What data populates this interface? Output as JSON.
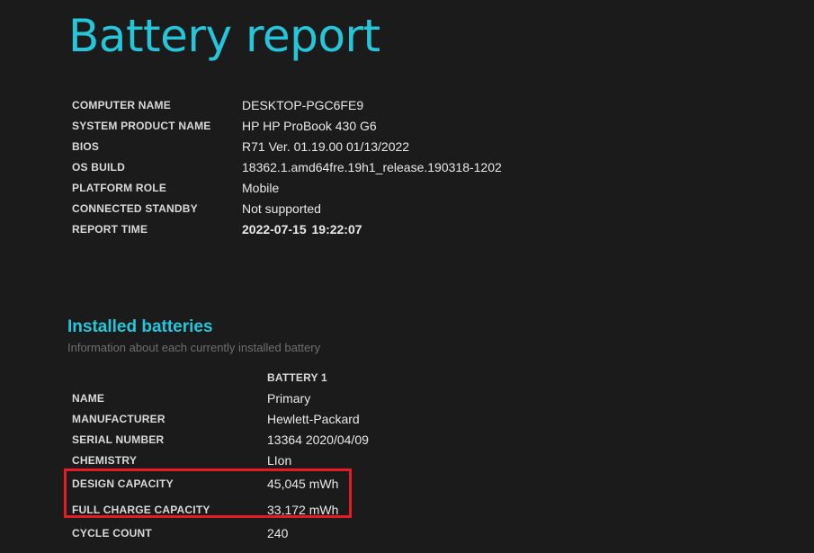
{
  "report": {
    "title": "Battery report"
  },
  "system_info": [
    {
      "key": "COMPUTER NAME",
      "value": "DESKTOP-PGC6FE9"
    },
    {
      "key": "SYSTEM PRODUCT NAME",
      "value": "HP HP ProBook 430 G6"
    },
    {
      "key": "BIOS",
      "value": "R71 Ver. 01.19.00 01/13/2022"
    },
    {
      "key": "OS BUILD",
      "value": "18362.1.amd64fre.19h1_release.190318-1202"
    },
    {
      "key": "PLATFORM ROLE",
      "value": "Mobile"
    },
    {
      "key": "CONNECTED STANDBY",
      "value": "Not supported"
    },
    {
      "key": "REPORT TIME",
      "value": "2022-07-15  19:22:07"
    }
  ],
  "installed_batteries": {
    "title": "Installed batteries",
    "subtitle": "Information about each currently installed battery",
    "column_header": "BATTERY 1",
    "rows": [
      {
        "key": "NAME",
        "value": "Primary"
      },
      {
        "key": "MANUFACTURER",
        "value": "Hewlett-Packard"
      },
      {
        "key": "SERIAL NUMBER",
        "value": "13364 2020/04/09"
      },
      {
        "key": "CHEMISTRY",
        "value": "LIon"
      },
      {
        "key": "DESIGN CAPACITY",
        "value": "45,045 mWh"
      },
      {
        "key": "FULL CHARGE CAPACITY",
        "value": "33,172 mWh"
      },
      {
        "key": "CYCLE COUNT",
        "value": "240"
      }
    ]
  },
  "colors": {
    "background": "#1b1b1b",
    "accent": "#26c6da",
    "highlight_box": "#e51c24"
  }
}
